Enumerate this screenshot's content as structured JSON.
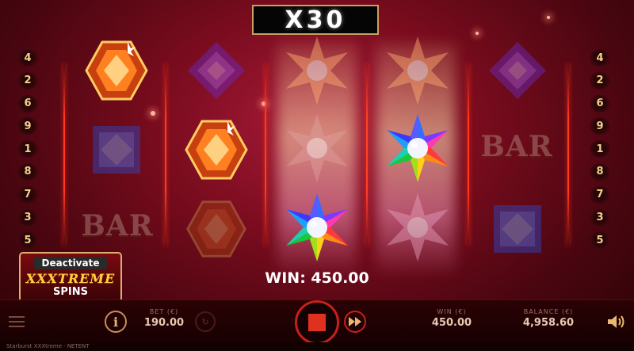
{
  "game": {
    "multiplier": "X30",
    "win_label": "WIN: 450.00",
    "bar_symbol": "BAR"
  },
  "paylines": {
    "left": [
      "4",
      "2",
      "6",
      "9",
      "1",
      "8",
      "7",
      "3",
      "5"
    ],
    "right": [
      "4",
      "2",
      "6",
      "9",
      "1",
      "8",
      "7",
      "3",
      "5"
    ]
  },
  "feature_button": {
    "line1": "Deactivate",
    "line2": "XXXTREME",
    "line3": "SPINS"
  },
  "bottom_bar": {
    "bet_label": "BET (€)",
    "bet_value": "190.00",
    "win_label": "WIN (€)",
    "win_value": "450.00",
    "balance_label": "BALANCE (€)",
    "balance_value": "4,958.60"
  },
  "footer": {
    "text": "Starburst XXXtreme · NETENT"
  },
  "colors": {
    "accent_gold": "#d8b070",
    "stop_button": "#c8201a",
    "payline_text": "#f3d08a"
  },
  "icons": [
    "menu-icon",
    "info-icon",
    "autoplay-icon",
    "stop-icon",
    "fast-forward-icon",
    "sound-icon"
  ]
}
